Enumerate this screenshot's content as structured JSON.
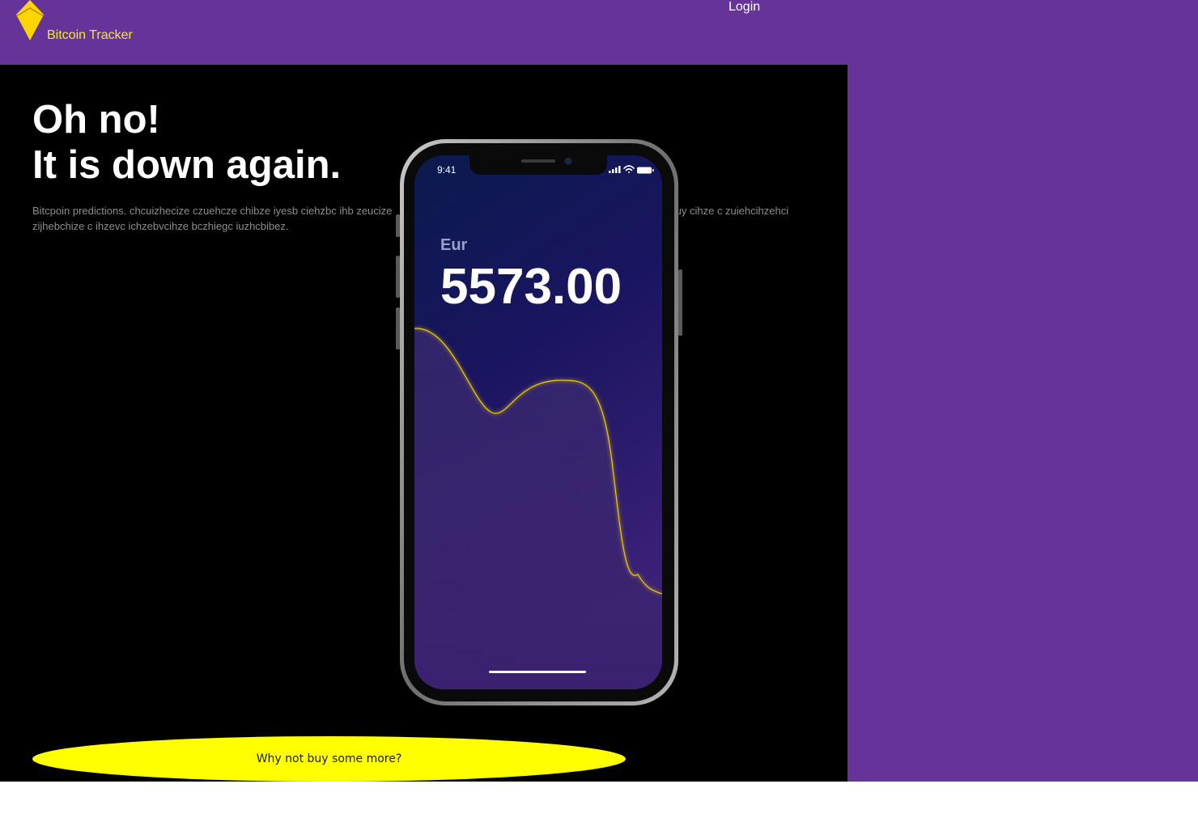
{
  "header": {
    "brand": "Bitcoin Tracker",
    "login_label": "Login",
    "logo_icon": "bitcoin-diamond-icon"
  },
  "hero": {
    "headline_line1": "Oh no!",
    "headline_line2": "It is down again.",
    "description_left": "Bitcpoin predictions. chcuizhecize czuehcze chibze iyesb ciehzbc ihb zeucize",
    "description_right": "euy cihze c zuiehcihzehci",
    "description_line2": "zijhebchize c ihzevc ichzebvcihze bczhiegc iuzhcbibez.",
    "cta_label": "Why not buy some more?"
  },
  "phone": {
    "status_time": "9:41",
    "currency": "Eur",
    "price": "5573.00",
    "status_icons": [
      "signal-icon",
      "wifi-icon",
      "battery-icon"
    ]
  },
  "colors": {
    "header_bg": "#663399",
    "brand_text": "#f5e63a",
    "hero_bg": "#000000",
    "cta_bg": "#ffff00",
    "chart_line": "#f0d000"
  }
}
